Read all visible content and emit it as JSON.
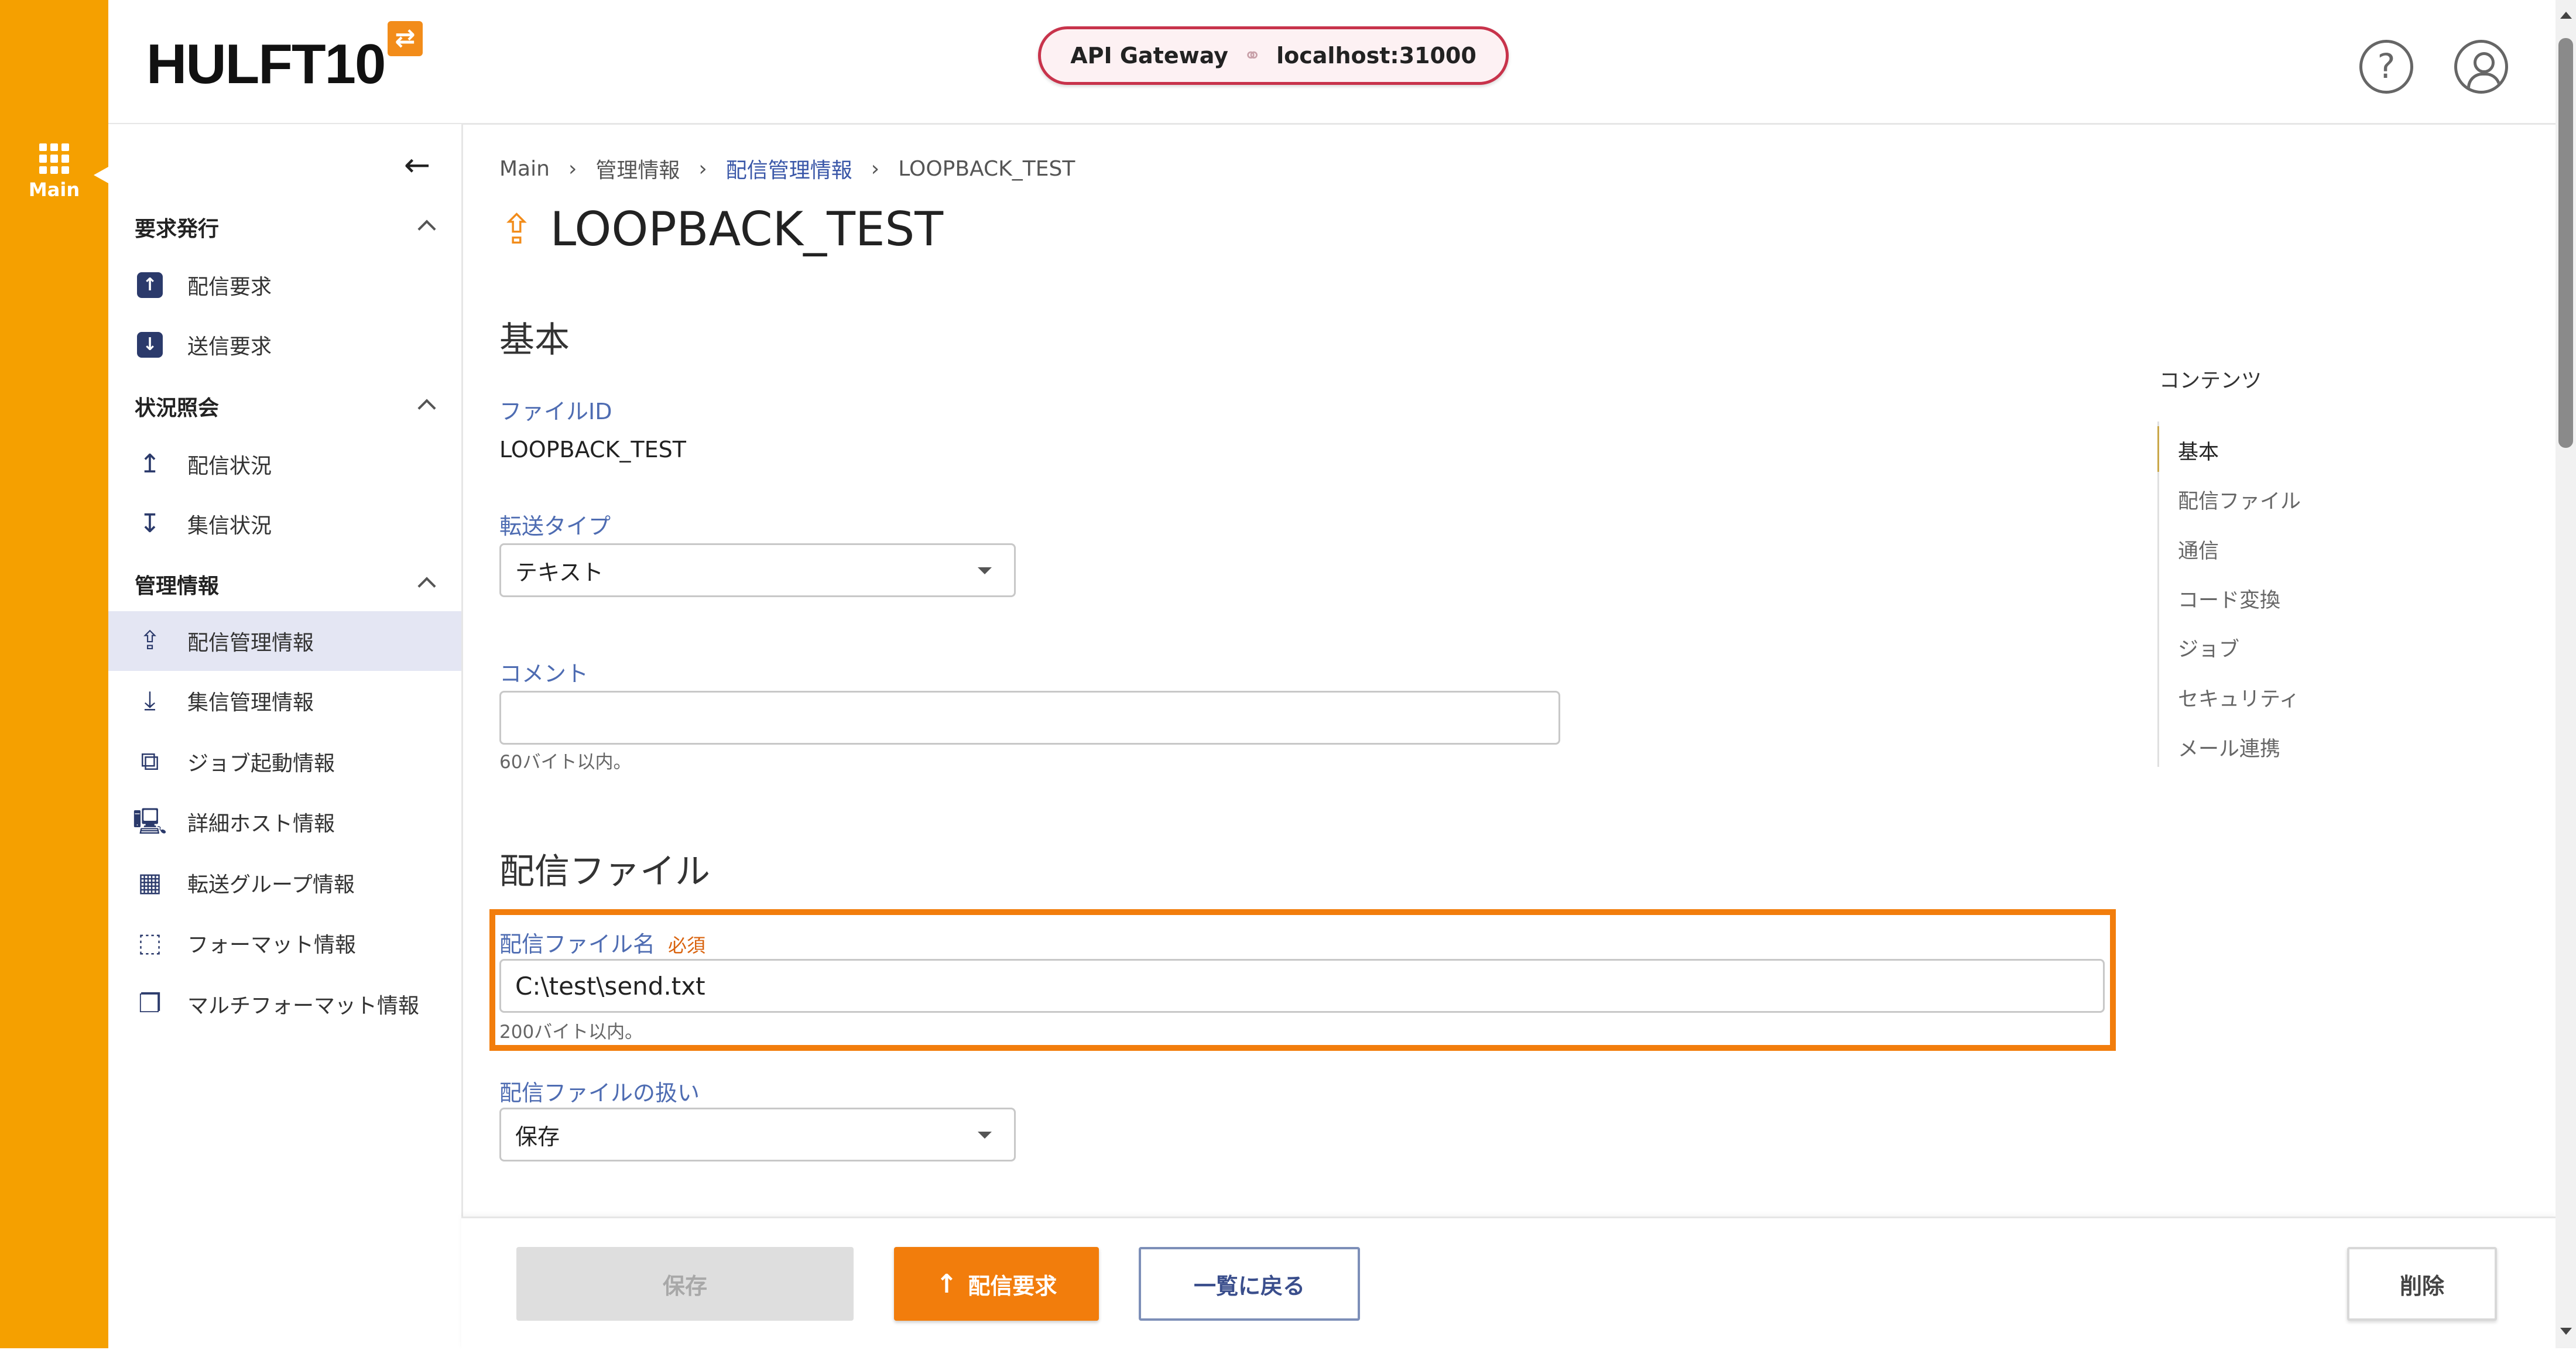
{
  "rail": {
    "main_label": "Main"
  },
  "header": {
    "logo": "HULFT10",
    "gateway_label": "API Gateway",
    "gateway_host": "localhost:31000",
    "help_icon": "?"
  },
  "sidebar": {
    "collapse_icon": "←",
    "sections": [
      {
        "title": "要求発行",
        "items": [
          "配信要求",
          "送信要求"
        ]
      },
      {
        "title": "状況照会",
        "items": [
          "配信状況",
          "集信状況"
        ]
      },
      {
        "title": "管理情報",
        "items": [
          "配信管理情報",
          "集信管理情報",
          "ジョブ起動情報",
          "詳細ホスト情報",
          "転送グループ情報",
          "フォーマット情報",
          "マルチフォーマット情報"
        ]
      }
    ],
    "active_item": "配信管理情報"
  },
  "breadcrumb": [
    "Main",
    "管理情報",
    "配信管理情報",
    "LOOPBACK_TEST"
  ],
  "page_title": "LOOPBACK_TEST",
  "basic": {
    "heading": "基本",
    "file_id_label": "ファイルID",
    "file_id_value": "LOOPBACK_TEST",
    "transfer_type_label": "転送タイプ",
    "transfer_type_value": "テキスト",
    "comment_label": "コメント",
    "comment_value": "",
    "comment_hint": "60バイト以内。"
  },
  "send_file": {
    "heading": "配信ファイル",
    "file_name_label": "配信ファイル名",
    "required_badge": "必須",
    "file_name_value": "C:\\test\\send.txt",
    "file_name_hint": "200バイト以内。",
    "handling_label": "配信ファイルの扱い",
    "handling_value": "保存"
  },
  "toc": {
    "title": "コンテンツ",
    "items": [
      "基本",
      "配信ファイル",
      "通信",
      "コード変換",
      "ジョブ",
      "セキュリティ",
      "メール連携"
    ],
    "active": "基本"
  },
  "footer": {
    "save": "保存",
    "request": "配信要求",
    "back": "一覧に戻る",
    "delete": "削除"
  },
  "colors": {
    "rail": "#f5a000",
    "accent": "#f27d0c",
    "gateway_border": "#c8334b",
    "nav_icon": "#2b3a6b"
  }
}
